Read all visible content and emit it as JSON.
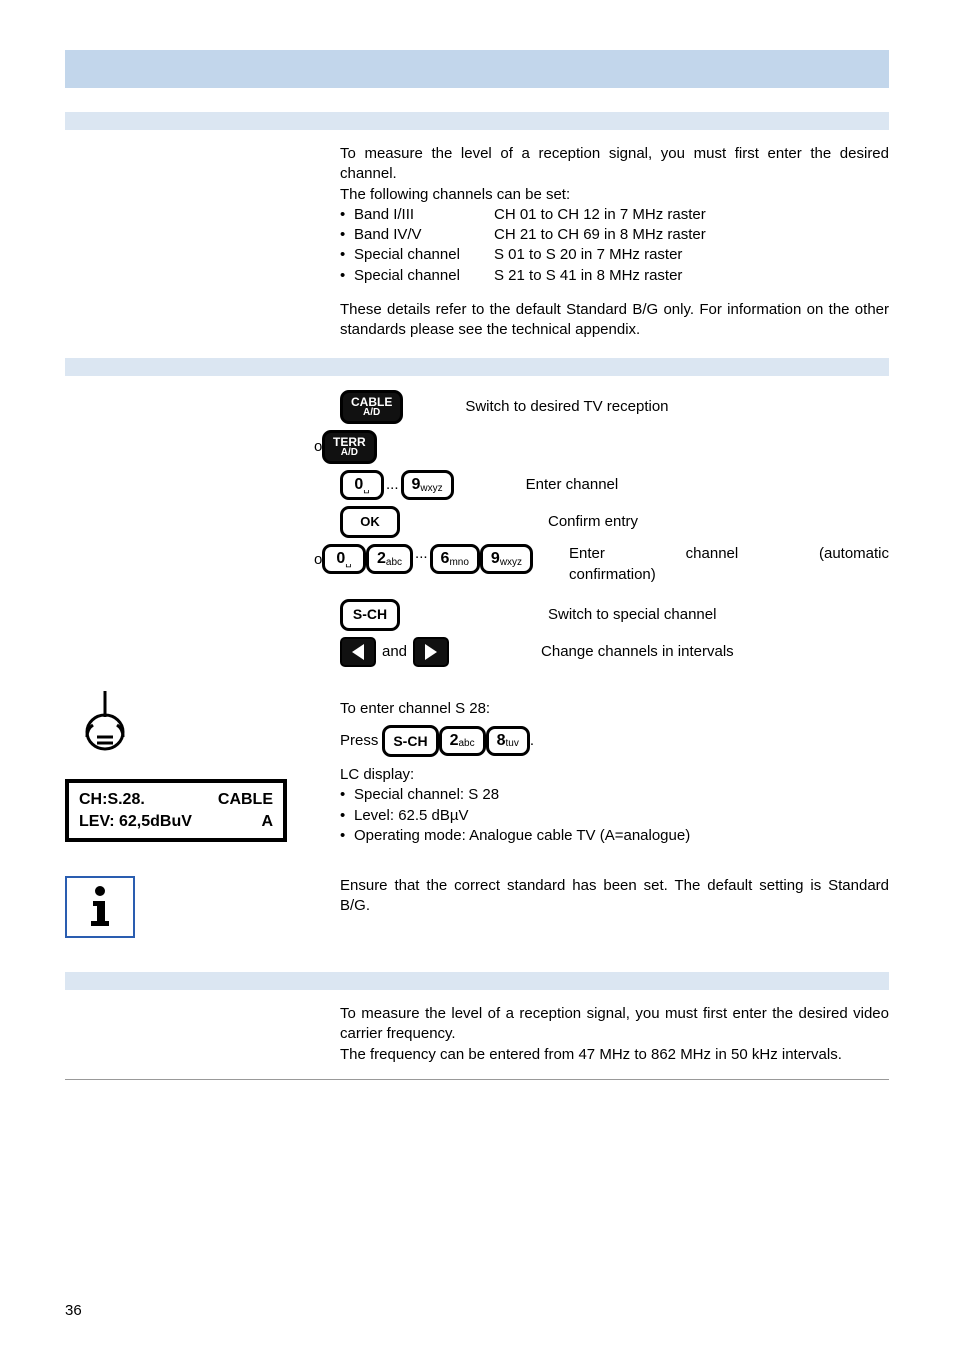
{
  "intro": {
    "line1": "To measure the level of a reception signal, you must first enter the desired channel.",
    "line2": "The following channels can be set:",
    "bands": [
      {
        "name": "Band I/III",
        "range": "CH 01 to CH 12 in 7 MHz raster"
      },
      {
        "name": "Band IV/V",
        "range": "CH 21 to CH 69 in 8 MHz raster"
      },
      {
        "name": "Special channel",
        "range": "S 01 to S 20 in 7 MHz raster"
      },
      {
        "name": "Special channel",
        "range": "S 21 to S 41 in 8 MHz raster"
      }
    ],
    "note": "These details refer to the default Standard B/G only. For information on the other standards please see the technical appendix."
  },
  "labels": {
    "or": "or",
    "and": "and",
    "press": "Press",
    "dots": "...",
    "dot": "."
  },
  "buttons": {
    "cable": {
      "top": "CABLE",
      "bot": "A/D"
    },
    "terr": {
      "top": "TERR",
      "bot": "A/D"
    },
    "d0": "0",
    "d0sub": "␣",
    "d2": "2",
    "d2sub": "abc",
    "d6": "6",
    "d6sub": "mno",
    "d8": "8",
    "d8sub": "tuv",
    "d9": "9",
    "d9sub": "wxyz",
    "ok": "OK",
    "sch": "S-CH"
  },
  "steps": {
    "switchTV": "Switch to desired TV reception",
    "enterCh": "Enter channel",
    "confirm": "Confirm entry",
    "enterAuto1": "Enter",
    "enterAuto2": "channel",
    "enterAuto3": "(automatic",
    "enterAuto4": "confirmation)",
    "special": "Switch to special channel",
    "interval": "Change channels in intervals"
  },
  "example": {
    "title": "To enter channel S 28:",
    "lcdHeading": "LC display:",
    "lcdItems": [
      "Special channel: S 28",
      "Level: 62.5 dBµV",
      "Operating mode: Analogue cable TV (A=analogue)"
    ]
  },
  "lcd": {
    "l1a": "CH:S.28.",
    "l1b": "CABLE",
    "l2a": "LEV: 62,5dBuV",
    "l2b": "A"
  },
  "info": "Ensure that the correct standard has been set. The default setting is Standard B/G.",
  "freq": {
    "p1": "To measure the level of a reception signal, you must first enter the desired video carrier frequency.",
    "p2": "The frequency can be entered from 47 MHz to 862 MHz in 50 kHz intervals."
  },
  "pageNumber": "36"
}
